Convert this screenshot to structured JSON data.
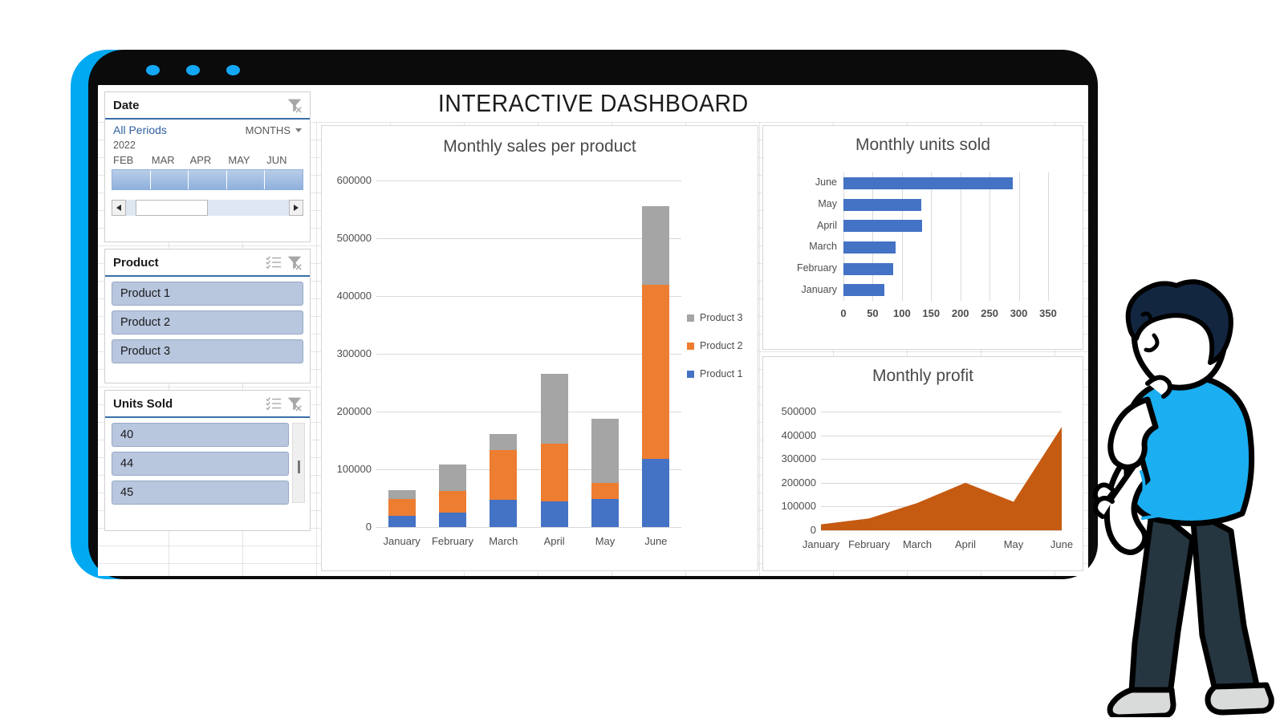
{
  "device": {
    "camera_dots": [
      "camera-dot-1",
      "camera-dot-2",
      "camera-dot-3"
    ],
    "accent_color": "#00A9F1",
    "frame_color": "#0b0b0b"
  },
  "header": {
    "title": "INTERACTIVE DASHBOARD"
  },
  "slicers": {
    "date": {
      "title": "Date",
      "clear_filter_icon": "clear-filter-icon",
      "all_periods_label": "All Periods",
      "level_label": "MONTHS",
      "year": "2022",
      "month_ticks": [
        "FEB",
        "MAR",
        "APR",
        "MAY",
        "JUN"
      ]
    },
    "product": {
      "title": "Product",
      "multiselect_icon": "multi-select-icon",
      "clear_filter_icon": "clear-filter-icon",
      "items": [
        "Product 1",
        "Product 2",
        "Product 3"
      ]
    },
    "units_sold": {
      "title": "Units Sold",
      "multiselect_icon": "multi-select-icon",
      "clear_filter_icon": "clear-filter-icon",
      "items": [
        "40",
        "44",
        "45"
      ]
    }
  },
  "colors": {
    "product1": "#4472C4",
    "product2": "#ED7D31",
    "product3": "#A5A5A5",
    "profit_area": "#C55A11",
    "slicer_item": "#B8C6DE",
    "accent_blue": "#00A9F1"
  },
  "chart_data": [
    {
      "type": "bar",
      "id": "monthly-sales-per-product",
      "title": "Monthly sales per product",
      "stacked": true,
      "orientation": "vertical",
      "categories": [
        "January",
        "February",
        "March",
        "April",
        "May",
        "June"
      ],
      "series": [
        {
          "name": "Product 1",
          "color": "#4472C4",
          "values": [
            20000,
            25000,
            47000,
            44000,
            49000,
            118000
          ]
        },
        {
          "name": "Product 2",
          "color": "#ED7D31",
          "values": [
            28000,
            38000,
            87000,
            101000,
            28000,
            301000
          ]
        },
        {
          "name": "Product 3",
          "color": "#A5A5A5",
          "values": [
            16000,
            46000,
            27000,
            120000,
            110000,
            136000
          ]
        }
      ],
      "totals": [
        64000,
        109000,
        161000,
        265000,
        187000,
        555000
      ],
      "xlabel": "",
      "ylabel": "",
      "ylim": [
        0,
        600000
      ],
      "yticks": [
        0,
        100000,
        200000,
        300000,
        400000,
        500000,
        600000
      ],
      "ytick_labels": [
        "0",
        "100000",
        "200000",
        "300000",
        "400000",
        "500000",
        "600000"
      ],
      "grid": true,
      "legend": [
        "Product 3",
        "Product 2",
        "Product 1"
      ],
      "legend_position": "right"
    },
    {
      "type": "bar",
      "id": "monthly-units-sold",
      "title": "Monthly units sold",
      "orientation": "horizontal",
      "categories": [
        "June",
        "May",
        "April",
        "March",
        "February",
        "January"
      ],
      "values": [
        290,
        133,
        135,
        89,
        85,
        70
      ],
      "xlim": [
        0,
        350
      ],
      "xticks": [
        0,
        50,
        100,
        150,
        200,
        250,
        300,
        350
      ],
      "xtick_labels": [
        "0",
        "50",
        "100",
        "150",
        "200",
        "250",
        "300",
        "350"
      ],
      "color": "#4472C4",
      "grid": true,
      "legend": []
    },
    {
      "type": "area",
      "id": "monthly-profit",
      "title": "Monthly profit",
      "categories": [
        "January",
        "February",
        "March",
        "April",
        "May",
        "June"
      ],
      "values": [
        25000,
        50000,
        115000,
        200000,
        120000,
        435000
      ],
      "ylim": [
        0,
        500000
      ],
      "yticks": [
        0,
        100000,
        200000,
        300000,
        400000,
        500000
      ],
      "ytick_labels": [
        "0",
        "100000",
        "200000",
        "300000",
        "400000",
        "500000"
      ],
      "color": "#C55A11",
      "grid": true,
      "legend": []
    }
  ],
  "illustration": {
    "name": "person-pointing-at-dashboard",
    "shirt_color": "#1BAEF0",
    "hair_color": "#122640",
    "pants_color": "#253641",
    "shoe_color": "#D9DBDB"
  }
}
